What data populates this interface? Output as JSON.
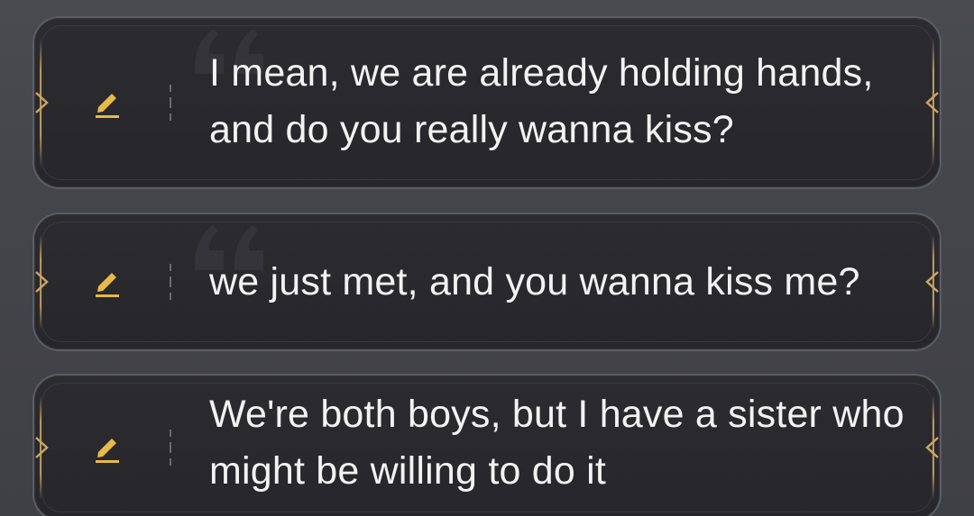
{
  "colors": {
    "accent_gold": "#e8b84a",
    "frame_gold": "#b9955c",
    "card_bg": "#28282c",
    "text": "#f2f2f2"
  },
  "icons": {
    "edit": "pencil-icon",
    "quote": "quote-mark-icon",
    "chevron_left": "chevron-right-icon",
    "chevron_right": "chevron-left-icon"
  },
  "suggestions": [
    {
      "text": "I mean, we are already holding hands, and do you really wanna kiss?"
    },
    {
      "text": "we just met, and you wanna kiss me?"
    },
    {
      "text": "We're both boys, but I have a sister who might be willing to do it"
    }
  ]
}
